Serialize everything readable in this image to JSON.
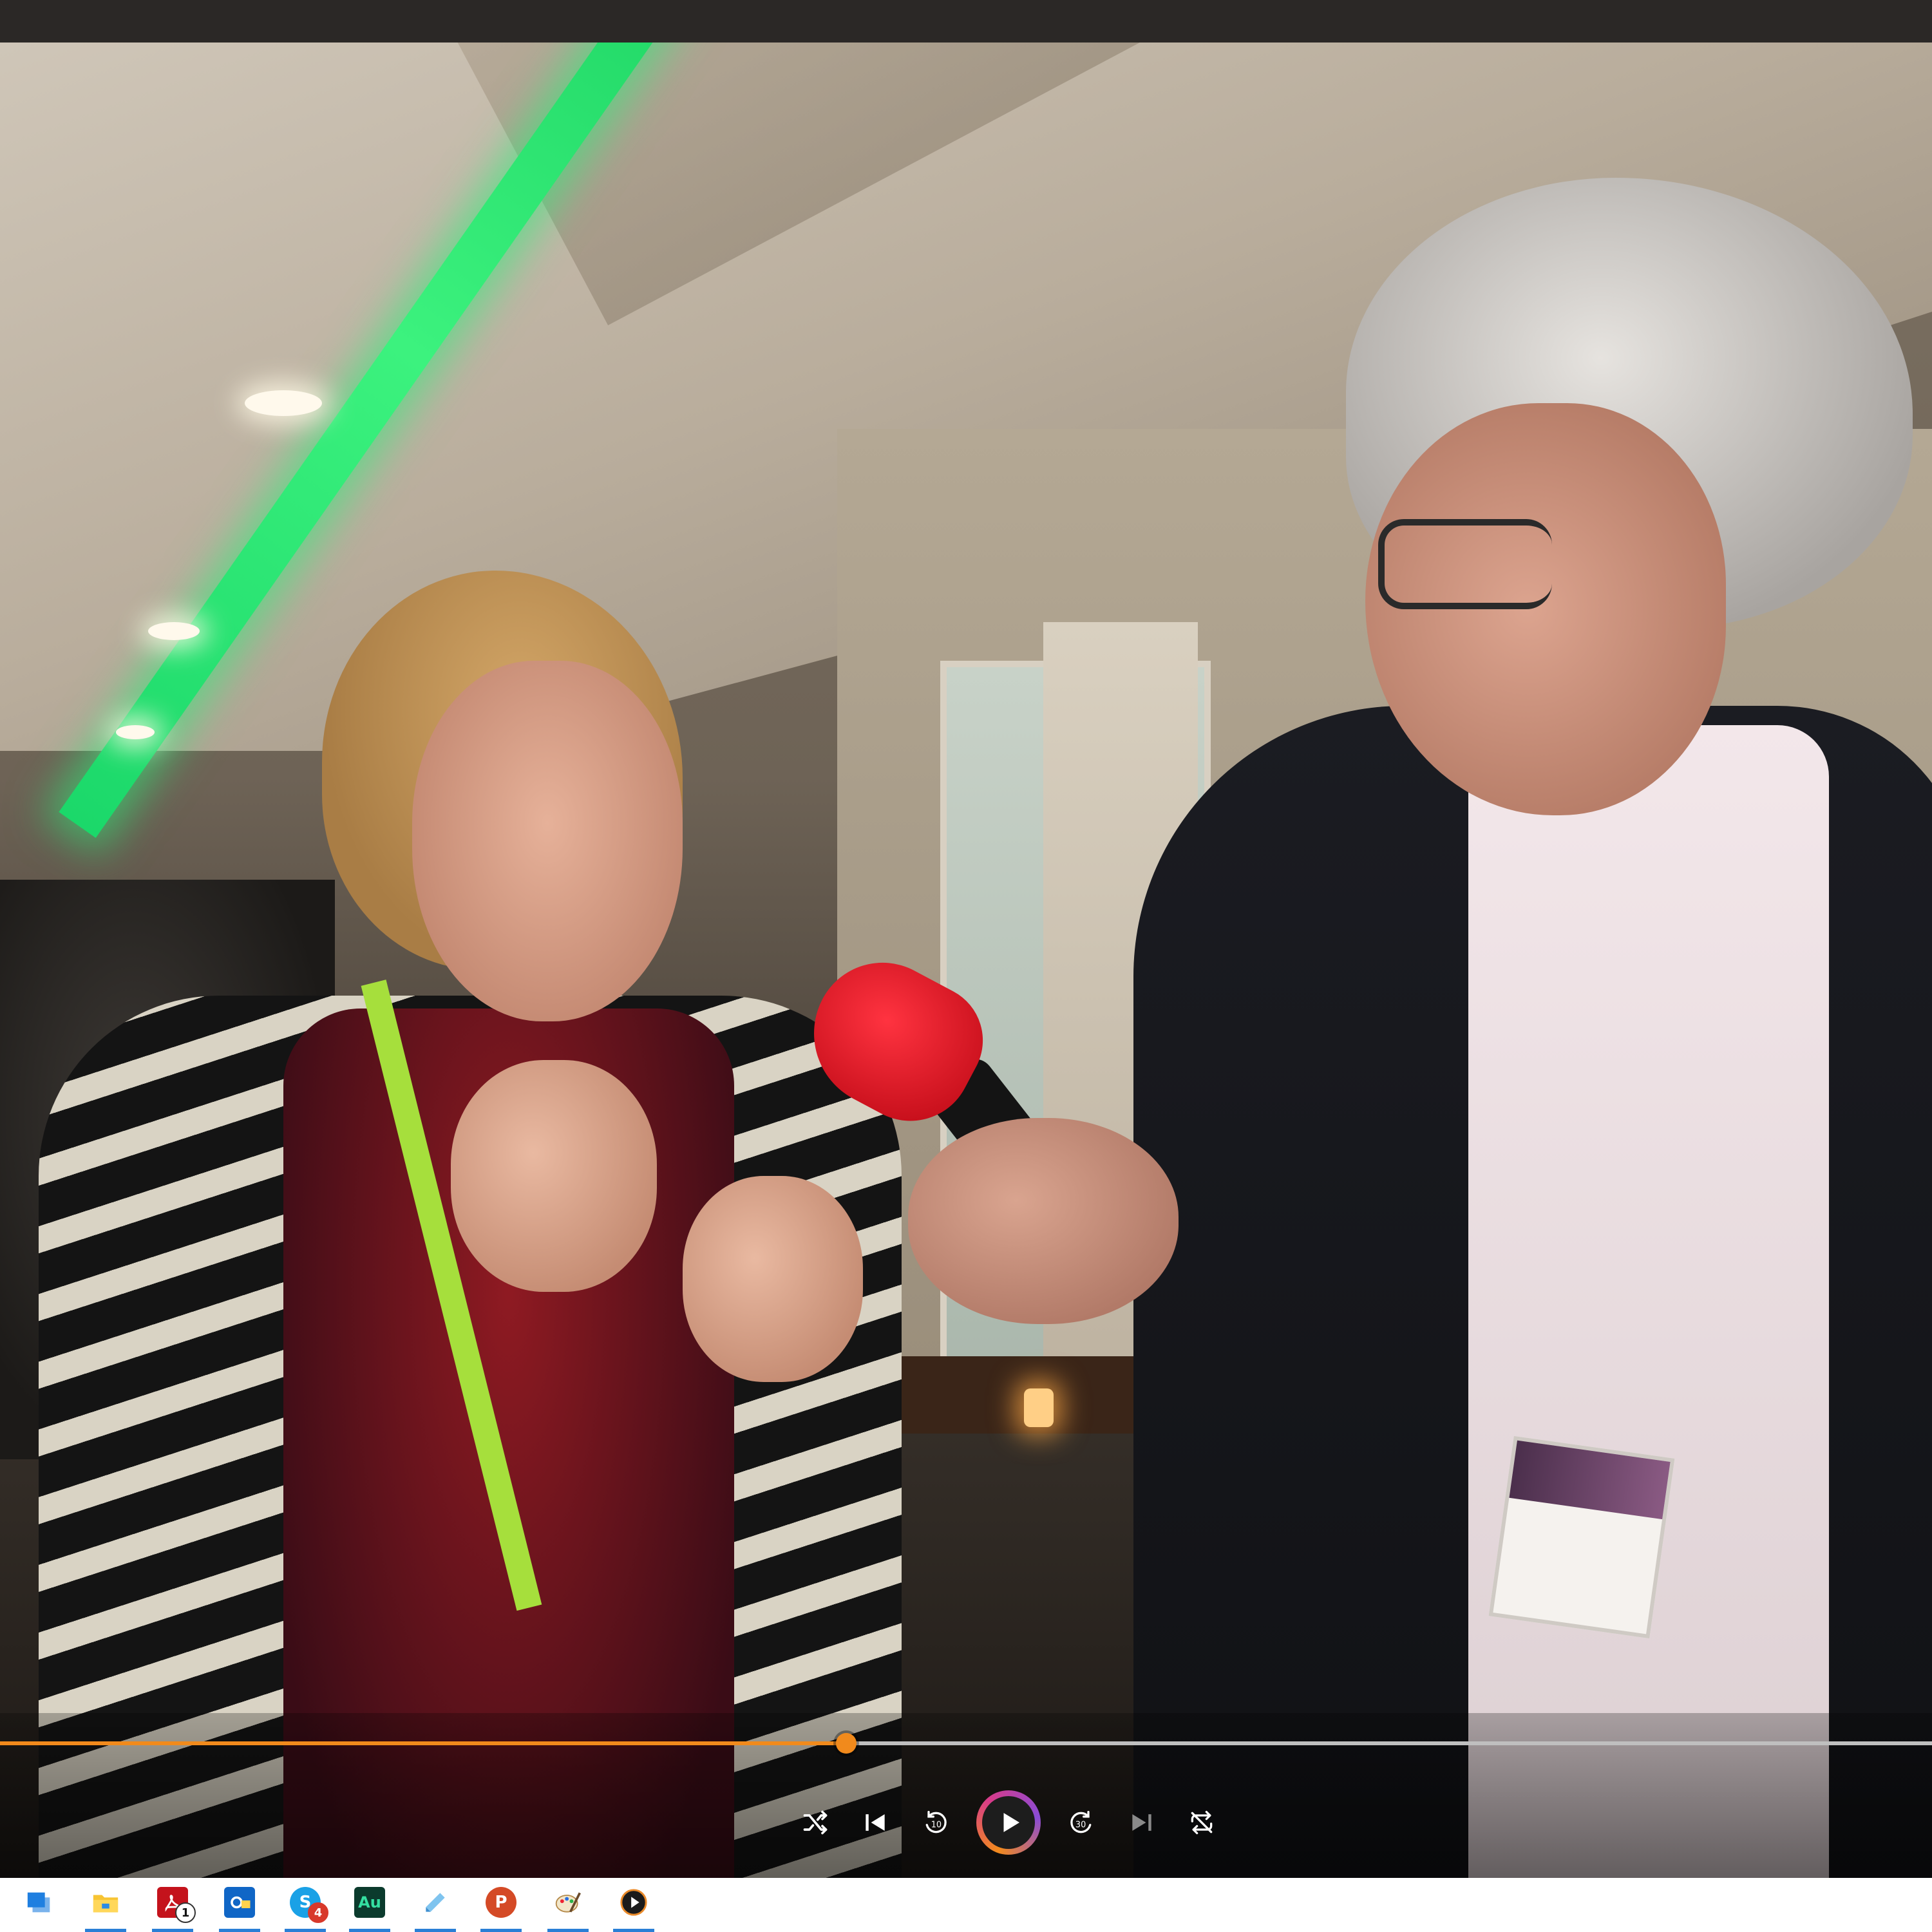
{
  "player": {
    "progress": 0.438,
    "controls": [
      {
        "name": "shuffle-icon",
        "label": ""
      },
      {
        "name": "previous-icon",
        "label": ""
      },
      {
        "name": "rewind-icon",
        "label": "10"
      },
      {
        "name": "play-icon",
        "label": ""
      },
      {
        "name": "forward-icon",
        "label": "30"
      },
      {
        "name": "next-icon",
        "label": ""
      },
      {
        "name": "repeat-icon",
        "label": ""
      }
    ],
    "colors": {
      "accent": "#f18a1c",
      "track": "#bfbfbf"
    }
  },
  "taskbar": {
    "apps": [
      {
        "name": "task-view",
        "icon": "task-view-icon"
      },
      {
        "name": "file-explorer",
        "icon": "folder-icon"
      },
      {
        "name": "acrobat",
        "icon": "acrobat-icon",
        "badge": "1"
      },
      {
        "name": "outlook",
        "icon": "outlook-icon"
      },
      {
        "name": "skype",
        "icon": "skype-icon",
        "badge": "4"
      },
      {
        "name": "audition",
        "icon": "audition-icon",
        "text": "Au"
      },
      {
        "name": "notes",
        "icon": "notes-icon"
      },
      {
        "name": "powerpoint",
        "icon": "powerpoint-icon",
        "text": "P"
      },
      {
        "name": "paint",
        "icon": "paint-icon"
      },
      {
        "name": "media-player",
        "icon": "media-player-icon"
      }
    ]
  }
}
